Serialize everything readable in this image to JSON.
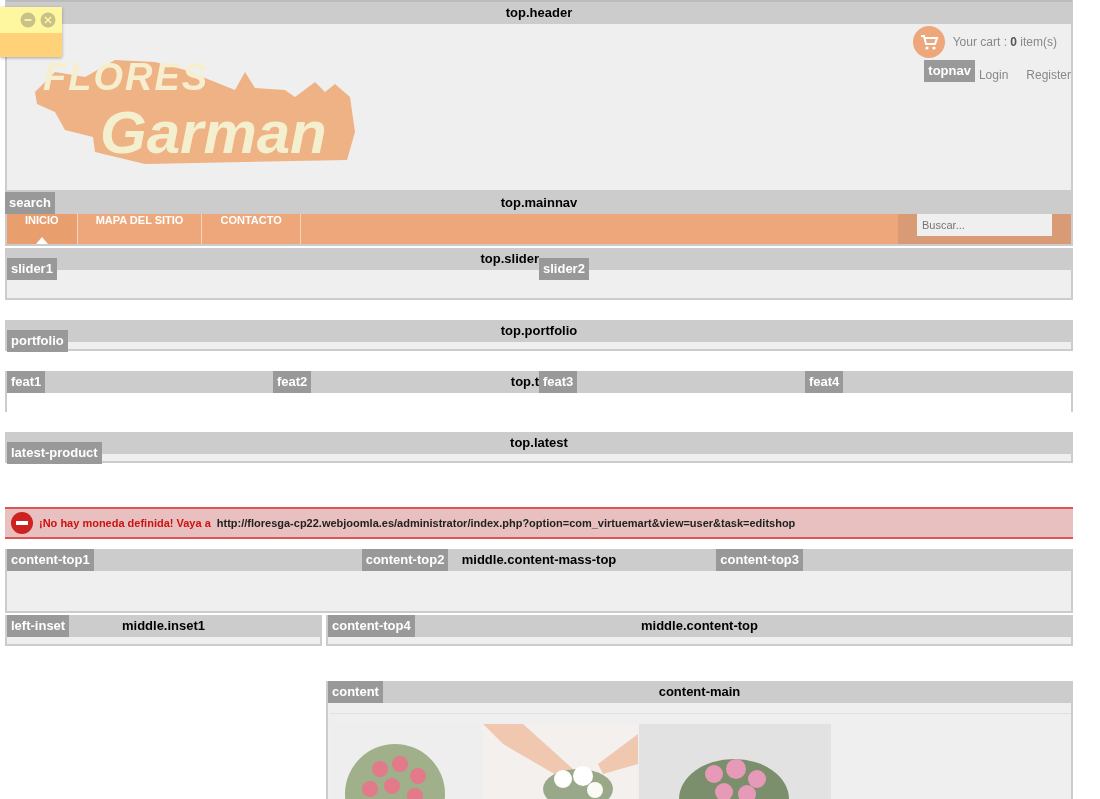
{
  "header": {
    "title": "top.header",
    "logo": {
      "line1": "FLORES",
      "line2": "Garman"
    },
    "cart": "Your cart : **0** item(s)",
    "links": [
      "Login",
      "Register"
    ],
    "tag": "topnav"
  },
  "mainnav": {
    "title": "top.mainnav",
    "tag": "search",
    "items": [
      {
        "label": "INICIO",
        "selected": true
      },
      {
        "label": "MAPA DEL SITIO",
        "selected": false
      },
      {
        "label": "CONTACTO",
        "selected": false
      }
    ],
    "search": {
      "placeholder": "Buscar..."
    }
  },
  "top_blocks": [
    {
      "title": "top.slider",
      "tags": [
        "slider1",
        "slider2"
      ],
      "body": true
    },
    {
      "title": "top.portfolio",
      "tags": [
        "portfolio"
      ],
      "body": true
    },
    {
      "title": "top.t",
      "tags": [
        "feat1",
        "feat2",
        "feat3",
        "feat4"
      ],
      "body": false
    },
    {
      "title": "top.latest",
      "tags": [
        "latest-product"
      ],
      "body": true
    }
  ],
  "error": {
    "message": "¡No hay moneda definida! Vaya a",
    "link": "http://floresga-cp22.webjoomla.es/administrator/index.php?option=com_virtuemart&view=user&task=editshop"
  },
  "mass_top": {
    "title": "middle.content-mass-top",
    "tags": [
      "content-top1",
      "content-top2",
      "content-top3"
    ]
  },
  "inset_row": [
    {
      "title": "middle.inset1",
      "tags": [
        "left-inset"
      ]
    },
    {
      "title": "middle.content-top",
      "tags": [
        "content-top4"
      ]
    }
  ],
  "content_main": {
    "title": "content-main",
    "tags": [
      "content"
    ],
    "photos": [
      {
        "kind": "picture"
      },
      {
        "kind": "picture"
      },
      {
        "kind": "picture"
      }
    ]
  }
}
